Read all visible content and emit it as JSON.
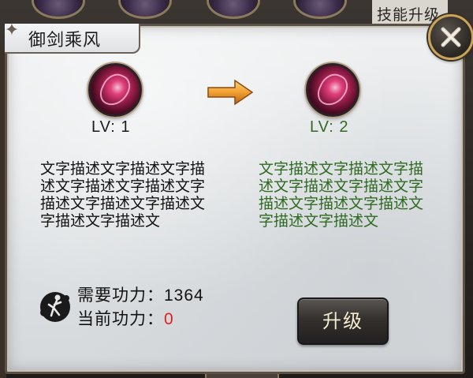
{
  "background": {
    "window_title": "技能升级"
  },
  "dialog": {
    "title": "御剑乘风",
    "current": {
      "level_label": "LV: 1",
      "description": "文字描述文字描述文字描述文字描述文字描述文字描述文字描述文字描述文字描述文字描述文"
    },
    "next": {
      "level_label": "LV: 2",
      "description": "文字描述文字描述文字描述文字描述文字描述文字描述文字描述文字描述文字描述文字描述文"
    },
    "required_power_label": "需要功力：",
    "required_power_value": "1364",
    "current_power_label": "当前功力：",
    "current_power_value": "0",
    "upgrade_button": "升级"
  },
  "colors": {
    "next_level_green": "#2e6a22",
    "insufficient_red": "#e0201c",
    "close_ring_gold": "#c9a45a"
  },
  "icons": {
    "skill": "sword-wind-skill-icon",
    "arrow": "right-arrow-icon",
    "close": "close-icon",
    "power": "martial-artist-icon"
  }
}
